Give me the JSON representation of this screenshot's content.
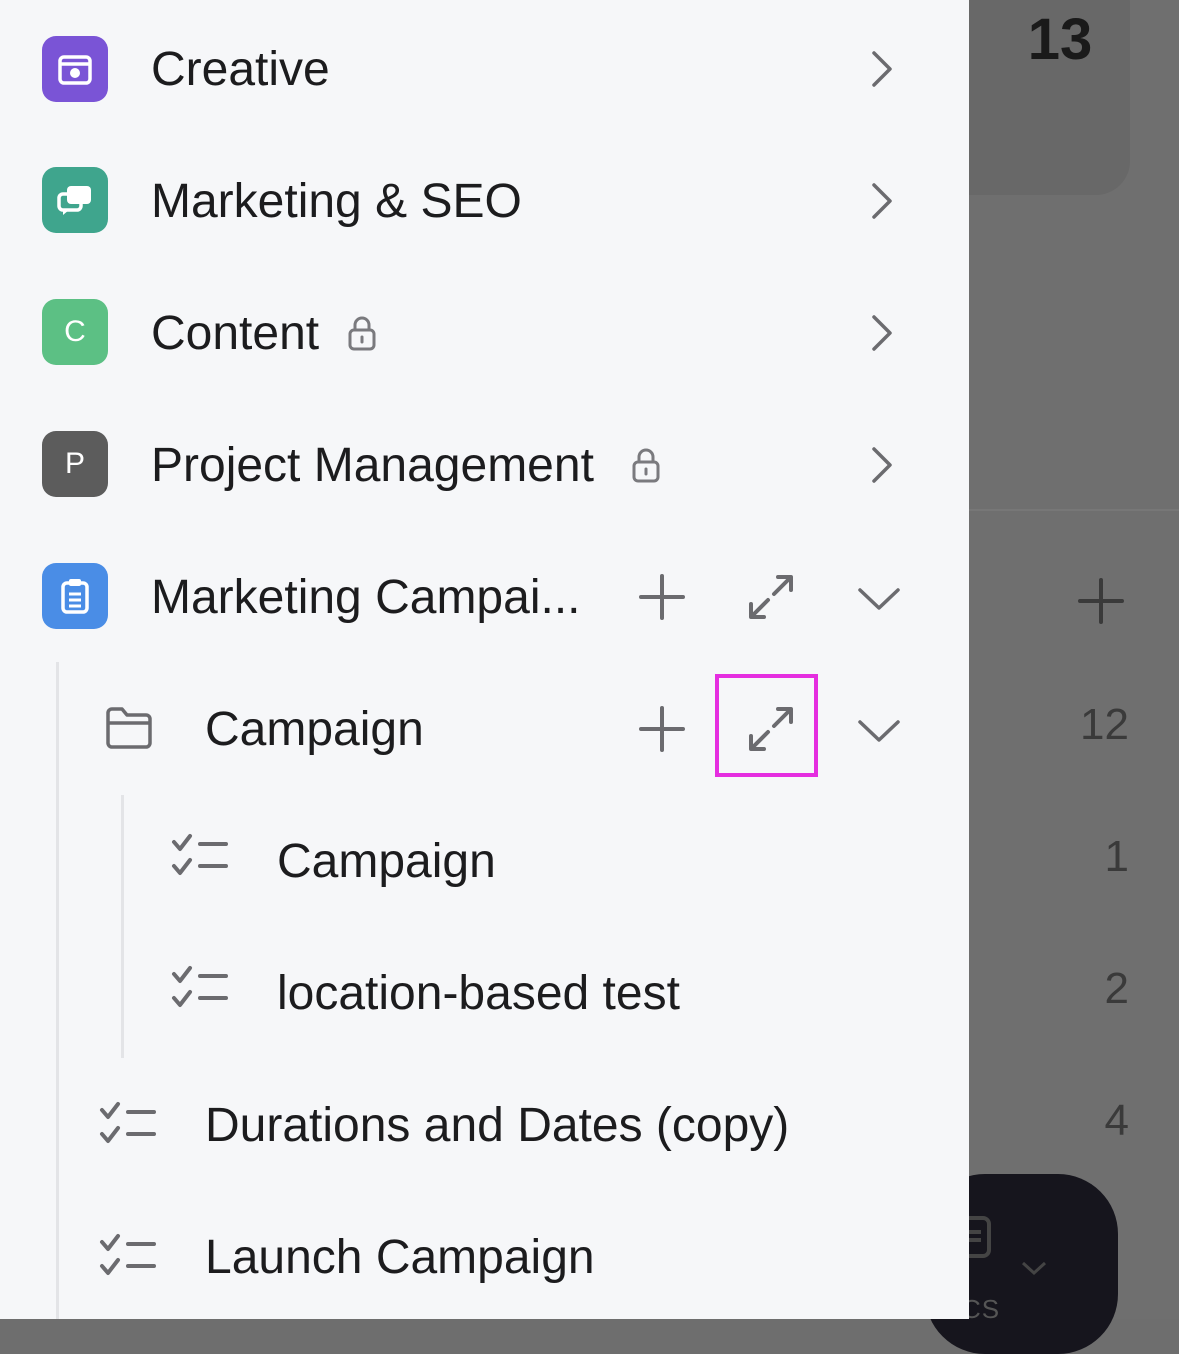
{
  "colors": {
    "creative": "#7a54d6",
    "marketing_seo": "#3fa58d",
    "content": "#5cc084",
    "project_management": "#5c5c5c",
    "marketing_campaign": "#4a8de6",
    "highlight": "#e52ee0"
  },
  "sidebar": {
    "spaces": [
      {
        "label": "Creative",
        "icon": "calendar-icon",
        "letter": ""
      },
      {
        "label": "Marketing & SEO",
        "icon": "chat-bubbles-icon",
        "letter": ""
      },
      {
        "label": "Content",
        "icon": "letter-avatar",
        "letter": "C",
        "locked": true
      },
      {
        "label": "Project Management",
        "icon": "letter-avatar",
        "letter": "P",
        "locked": true
      },
      {
        "label": "Marketing Campai...",
        "icon": "clipboard-icon",
        "letter": ""
      }
    ],
    "folder": {
      "label": "Campaign",
      "icon": "folder-icon"
    },
    "folder_lists": [
      {
        "label": "Campaign",
        "icon": "checklist-icon"
      },
      {
        "label": "location-based test",
        "icon": "checklist-icon"
      }
    ],
    "space_lists": [
      {
        "label": "Durations and Dates (copy)",
        "icon": "checklist-icon"
      },
      {
        "label": "Launch Campaign",
        "icon": "checklist-icon"
      }
    ]
  },
  "background": {
    "top_count": "13",
    "counts": [
      "12",
      "1",
      "2",
      "4"
    ],
    "bottom_label": "CS"
  }
}
